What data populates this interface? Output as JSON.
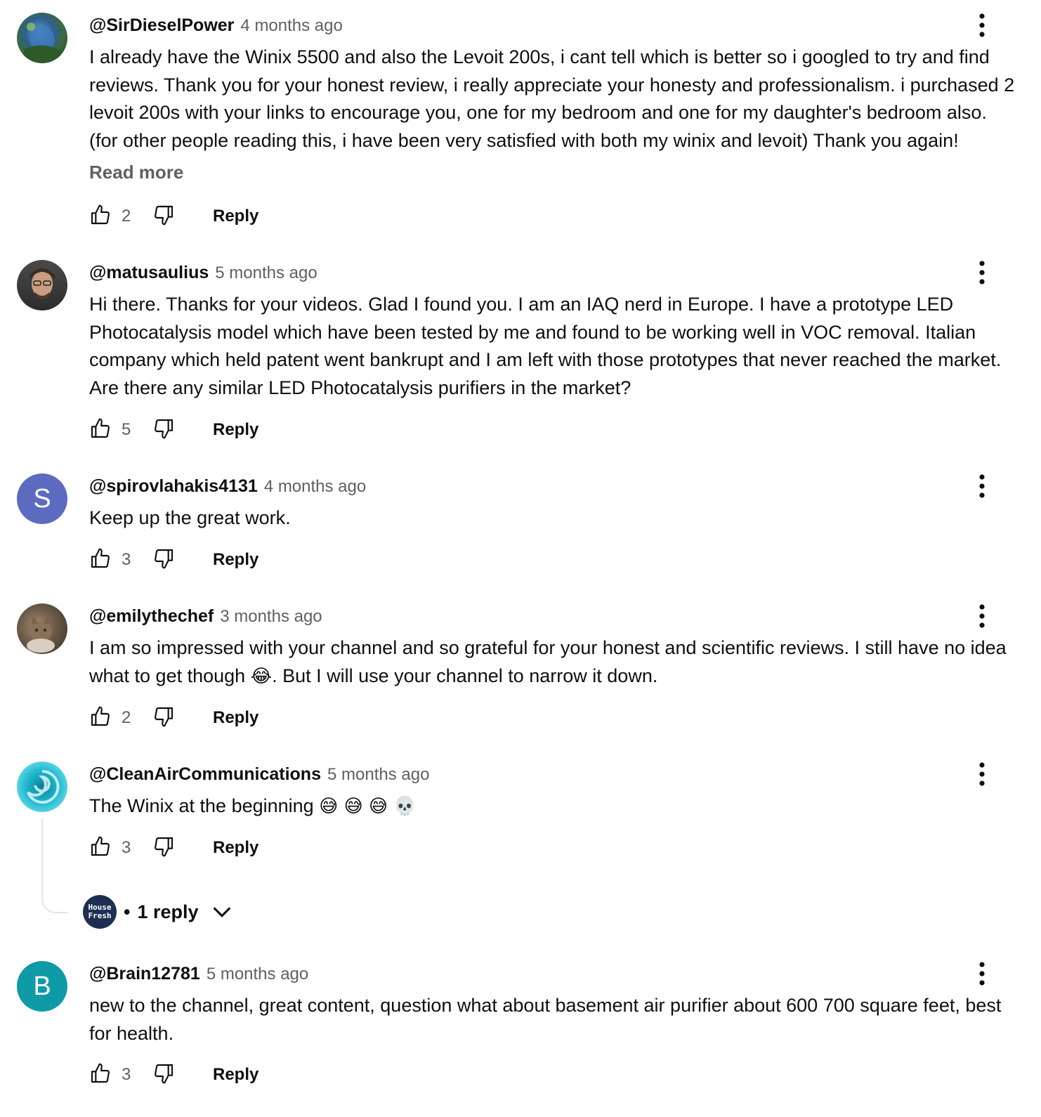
{
  "ui": {
    "reply_label": "Reply",
    "read_more": "Read more"
  },
  "comments": [
    {
      "author": "@SirDieselPower",
      "time": "4 months ago",
      "text": "I already have the Winix 5500 and also the Levoit 200s, i cant tell which is better so i googled to try and find reviews. Thank you for your honest review, i really appreciate your honesty and professionalism. i purchased 2 levoit 200s with your links to encourage you, one for my bedroom and one for my daughter's bedroom also. (for other people reading this, i have been very satisfied with both my winix and levoit) Thank you again!",
      "likes": "2",
      "avatar": "globe-landscape-photo"
    },
    {
      "author": "@matusaulius",
      "time": "5 months ago",
      "text": "Hi there. Thanks for your videos. Glad I found you. I am an IAQ nerd in Europe. I have a prototype LED Photocatalysis model which have been tested by me and found to be working well in VOC removal. Italian company which held patent went bankrupt and I am left with those prototypes that never reached the market. Are there any similar LED Photocatalysis purifiers in the market?",
      "likes": "5",
      "avatar": "man-with-glasses-photo"
    },
    {
      "author": "@spirovlahakis4131",
      "time": "4 months ago",
      "text": "Keep up the great work.",
      "likes": "3",
      "avatar_letter": "S",
      "avatar_color": "#5c6bc0"
    },
    {
      "author": "@emilythechef",
      "time": "3 months ago",
      "text_before": "I am so impressed with your channel and so grateful for your honest and scientific reviews. I still have no idea what to get though ",
      "emoji": "😂",
      "text_after": ". But I will use your channel to narrow it down.",
      "likes": "2",
      "avatar": "cat-photo"
    },
    {
      "author": "@CleanAirCommunications",
      "time": "5 months ago",
      "text": "The Winix at the beginning ",
      "emoji": "😅 😅 😅 💀",
      "likes": "3",
      "avatar": "teal-swirl-logo",
      "replies": {
        "count_label": "1 reply",
        "avatar_text_1": "House",
        "avatar_text_2": "Fresh"
      }
    },
    {
      "author": "@Brain12781",
      "time": "5 months ago",
      "text": "new to the channel, great content, question what about basement air purifier about 600 700 square feet, best for health.",
      "likes": "3",
      "avatar_letter": "B",
      "avatar_color": "#0e9aa7"
    }
  ]
}
